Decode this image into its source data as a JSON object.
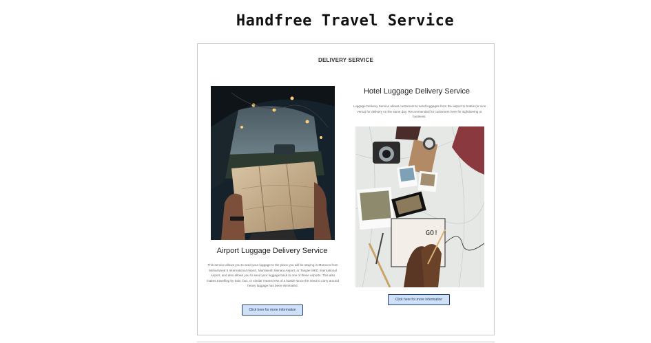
{
  "header": {
    "site_title": "Handfree Travel Service"
  },
  "delivery": {
    "heading": "DELIVERY SERVICE",
    "airport": {
      "title": "Airport Luggage Delivery Service",
      "description": "This service allows you to send your luggage to the place you will be staying in Morocco from Mohammed 5 International Airport, Marrakesh Menara Airport, or Tangier MED International Airport, and also allows you to send your luggage back to one of these airports. This also makes travelling by train, bus, or similar means less of a hassle since the need to carry around heavy luggage has been eliminated.",
      "button_label": "Click here for more information"
    },
    "hotel": {
      "title": "Hotel Luggage Delivery Service",
      "description": "Luggage Delivery Service allows customers to send luggages from the airport to hotels (or vice versa) for delivery on the same day. Recommended for customers here for sightseeing or business.",
      "button_label": "Click here for more information",
      "photo_note_text": "GO!"
    }
  }
}
